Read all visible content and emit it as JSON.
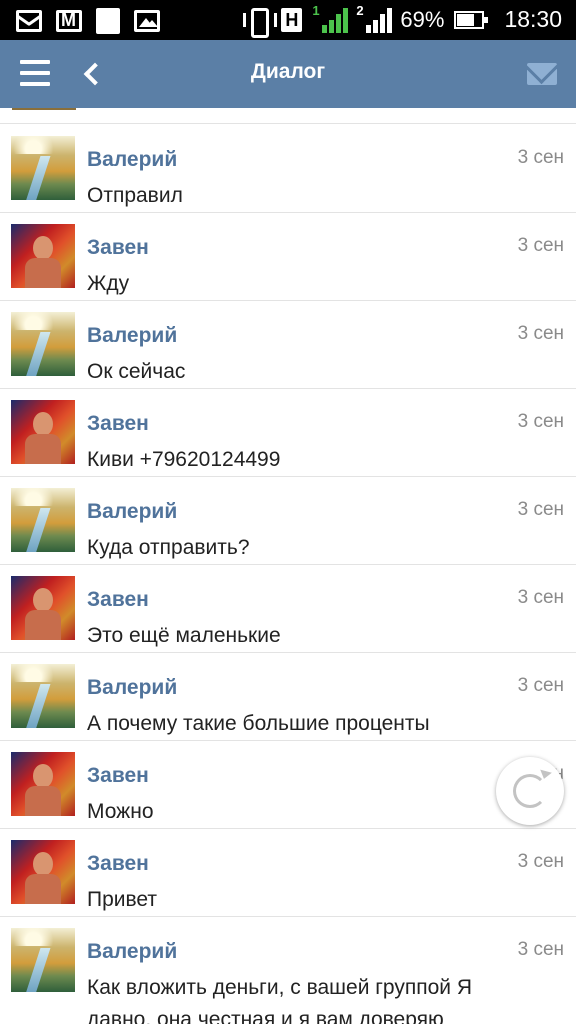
{
  "status_bar": {
    "battery_percent": "69%",
    "time": "18:30",
    "network_label": "H",
    "sim1": "1",
    "sim2": "2",
    "icons": [
      "mail-icon",
      "gmail-icon",
      "document-icon",
      "gallery-icon",
      "vibrate-icon",
      "network-icon",
      "signal-icon",
      "battery-icon"
    ]
  },
  "header": {
    "title": "Диалог",
    "menu_icon": "menu-icon",
    "back_icon": "chevron-left-icon",
    "mail_icon": "mail-icon",
    "background_color": "#5b7fa6"
  },
  "messages": [
    {
      "name": "Валерий",
      "time": "3 сен",
      "text": "Отправил"
    },
    {
      "name": "Завен",
      "time": "3 сен",
      "text": "Жду"
    },
    {
      "name": "Валерий",
      "time": "3 сен",
      "text": "Ок сейчас"
    },
    {
      "name": "Завен",
      "time": "3 сен",
      "text": "Киви +79620124499"
    },
    {
      "name": "Валерий",
      "time": "3 сен",
      "text": "Куда отправить?"
    },
    {
      "name": "Завен",
      "time": "3 сен",
      "text": "Это ещё маленькие"
    },
    {
      "name": "Валерий",
      "time": "3 сен",
      "text": "А почему такие большие проценты"
    },
    {
      "name": "Завен",
      "time": "3 сен",
      "text": "Можно"
    },
    {
      "name": "Завен",
      "time": "3 сен",
      "text": "Привет"
    },
    {
      "name": "Валерий",
      "time": "3 сен",
      "text": "Как вложить деньги, с вашей группой Я давно, она честная и я вам доверяю"
    }
  ],
  "refresh_icon": "refresh-icon",
  "colors": {
    "name": "#50739b",
    "time": "#8a8a8a",
    "text": "#222222"
  }
}
